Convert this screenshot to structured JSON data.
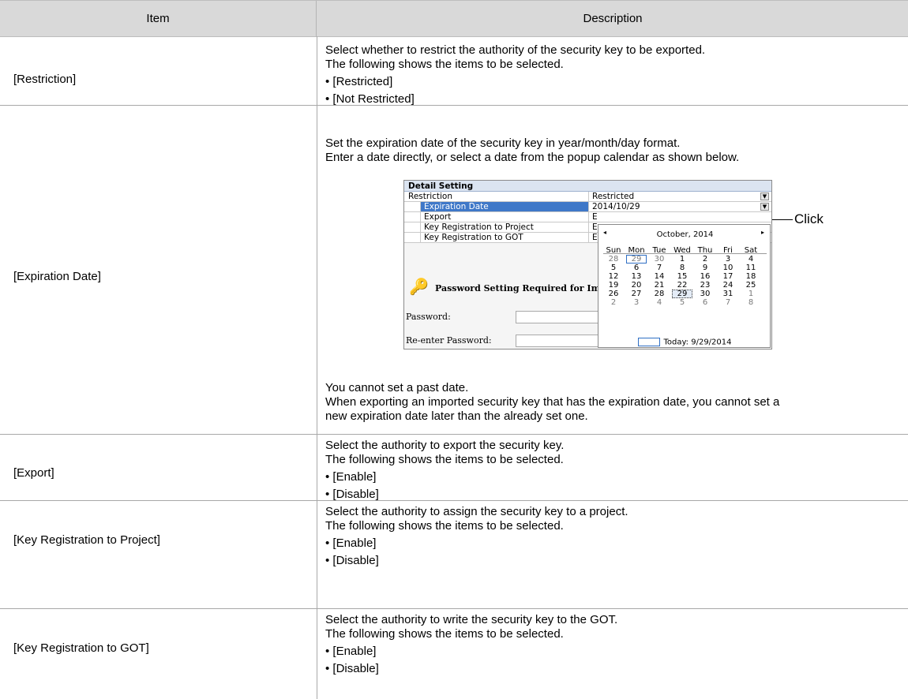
{
  "table": {
    "headers": {
      "item": "Item",
      "description": "Description"
    },
    "rows": [
      {
        "item": "[Restriction]",
        "lines": [
          "Select whether to restrict the authority of the security key to be exported.",
          "The following shows the items to be selected."
        ],
        "bullets": [
          "• [Restricted]",
          "• [Not Restricted]"
        ]
      },
      {
        "item": "[Expiration Date]",
        "lines": [
          "Set the expiration date of the security key in year/month/day format.",
          "Enter a date directly, or select a date from the popup calendar as shown below."
        ],
        "after_lines": [
          "You cannot set a past date.",
          "When exporting an imported security key that has the expiration date, you cannot set a",
          "new expiration date later than the already set one."
        ]
      },
      {
        "item": "[Export]",
        "lines": [
          "Select the authority to export the security key.",
          "The following shows the items to be selected."
        ],
        "bullets": [
          "• [Enable]",
          "• [Disable]"
        ]
      },
      {
        "item": "[Key Registration to Project]",
        "lines": [
          "Select the authority to assign the security key to a project.",
          "The following shows the items to be selected."
        ],
        "bullets": [
          "• [Enable]",
          "• [Disable]"
        ]
      },
      {
        "item": "[Key Registration to GOT]",
        "lines": [
          "Select the authority to write the security key to the GOT.",
          "The following shows the items to be selected."
        ],
        "bullets": [
          "• [Enable]",
          "• [Disable]"
        ]
      }
    ]
  },
  "screenshot": {
    "section_title": "Detail Setting",
    "rows": [
      {
        "label": "Restriction",
        "value": "Restricted"
      },
      {
        "label": "Expiration Date",
        "value": "2014/10/29"
      },
      {
        "label": "Export",
        "value": "E"
      },
      {
        "label": "Key Registration to Project",
        "value": "E"
      },
      {
        "label": "Key Registration to GOT",
        "value": "E"
      }
    ],
    "password_title": "Password Setting Required for Imp",
    "password_label": "Password:",
    "reenter_label": "Re-enter Password:",
    "icon": "key-icon",
    "calendar": {
      "prev": "◂",
      "next": "▸",
      "month": "October, 2014",
      "weekdays": [
        "Sun",
        "Mon",
        "Tue",
        "Wed",
        "Thu",
        "Fri",
        "Sat"
      ],
      "weeks": [
        [
          "28",
          "29",
          "30",
          "1",
          "2",
          "3",
          "4"
        ],
        [
          "5",
          "6",
          "7",
          "8",
          "9",
          "10",
          "11"
        ],
        [
          "12",
          "13",
          "14",
          "15",
          "16",
          "17",
          "18"
        ],
        [
          "19",
          "20",
          "21",
          "22",
          "23",
          "24",
          "25"
        ],
        [
          "26",
          "27",
          "28",
          "29",
          "30",
          "31",
          "1"
        ],
        [
          "2",
          "3",
          "4",
          "5",
          "6",
          "7",
          "8"
        ]
      ],
      "today_label": "Today: 9/29/2014"
    },
    "callout": "Click",
    "accent_color": "#3f78c8"
  }
}
